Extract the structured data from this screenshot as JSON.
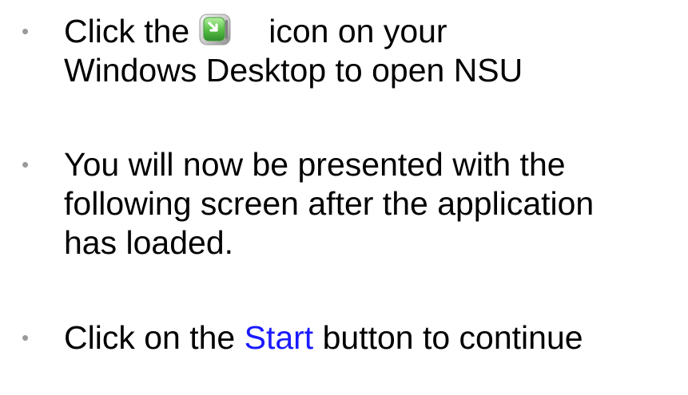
{
  "bullets": [
    {
      "marker": "•",
      "line1_before_icon": "Click the",
      "icon": "nsu-app-icon",
      "line1_after_icon": "icon on your",
      "line2": "Windows Desktop to open NSU"
    },
    {
      "marker": "•",
      "lines": [
        "You will now be presented with the",
        "following screen after the application",
        "has loaded."
      ]
    },
    {
      "marker": "•",
      "before_link": "Click on the ",
      "link": "Start",
      "after_link": " button to continue"
    }
  ],
  "colors": {
    "text": "#000000",
    "bullet": "#9a9a9a",
    "link": "#1a1aff",
    "icon_green": "#5cc24a"
  }
}
